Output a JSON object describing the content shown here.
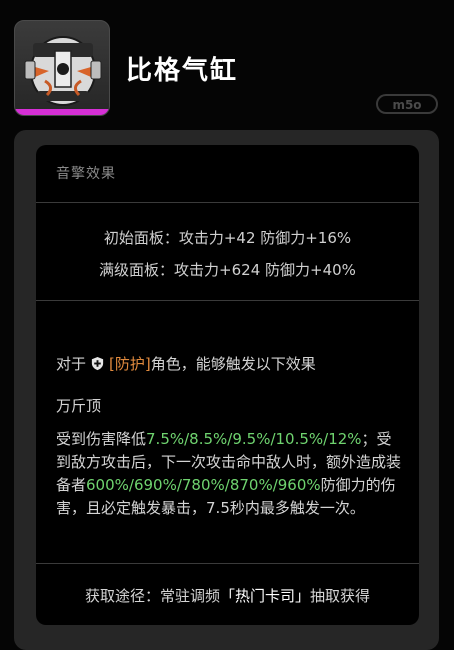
{
  "item": {
    "name": "比格气缸",
    "icon": "gas-cylinder-icon",
    "rarity_color": "#d62fd6"
  },
  "watermark": "m5o",
  "panel": {
    "section_title": "音擎效果",
    "base_stats": "初始面板：攻击力+42 防御力+16%",
    "max_stats": "满级面板：攻击力+624 防御力+40%",
    "condition": {
      "prefix": "对于",
      "shield_icon": "defense-shield-icon",
      "tag": "[防护]",
      "suffix": "角色，能够触发以下效果"
    },
    "effect_name": "万斤顶",
    "effect": {
      "part1": "受到伤害降低",
      "values1": "7.5%/8.5%/9.5%/10.5%/12%",
      "part2": "；受到敌方攻击后，下一次攻击命中敌人时，额外造成装备者",
      "values2": "600%/690%/780%/870%/960%",
      "part3": "防御力的伤害，且必定触发暴击，7.5秒内最多触发一次。"
    },
    "source": {
      "prefix": "获取途径：常驻调频",
      "highlight": "「热门卡司」",
      "suffix": "抽取获得"
    }
  },
  "colors": {
    "tag": "#e08a3e",
    "values": "#6fd36f"
  }
}
